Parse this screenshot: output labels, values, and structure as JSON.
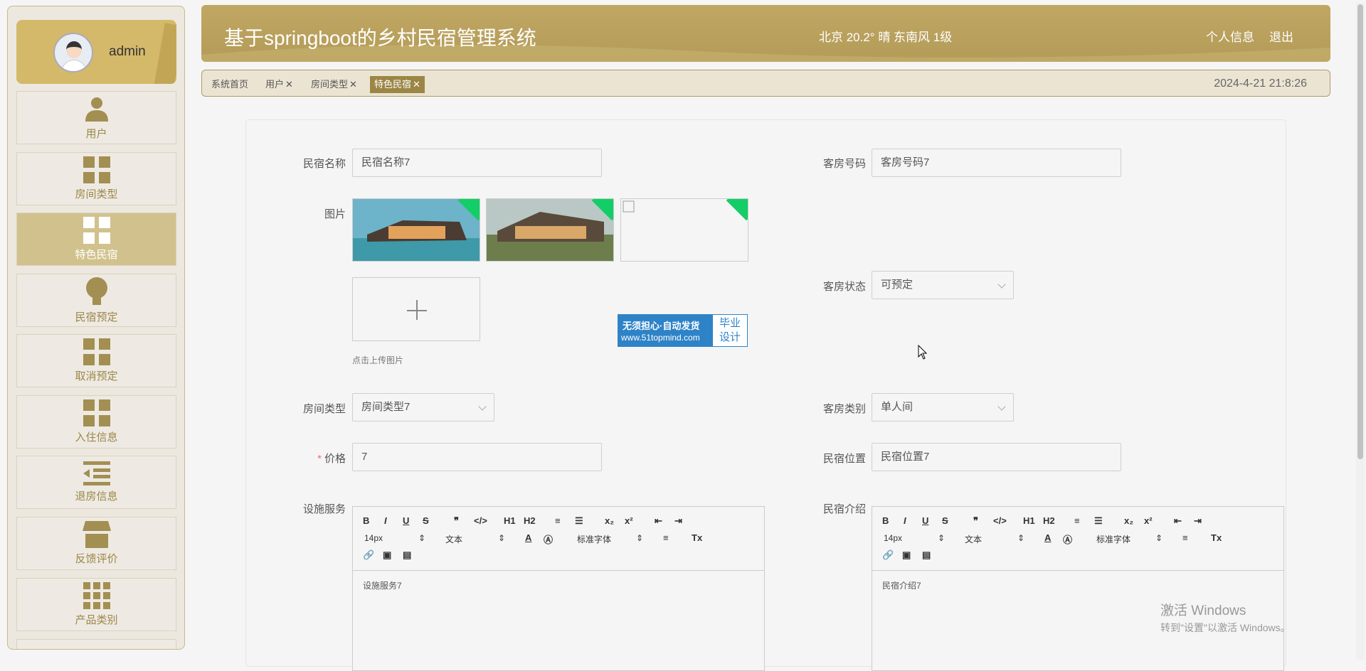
{
  "user": {
    "name": "admin"
  },
  "sidebar": {
    "items": [
      {
        "label": "用户",
        "icon": "user-icon"
      },
      {
        "label": "房间类型",
        "icon": "grid-icon"
      },
      {
        "label": "特色民宿",
        "icon": "grid-icon",
        "active": true
      },
      {
        "label": "民宿预定",
        "icon": "bulb-icon"
      },
      {
        "label": "取消预定",
        "icon": "grid-icon"
      },
      {
        "label": "入住信息",
        "icon": "grid-icon"
      },
      {
        "label": "退房信息",
        "icon": "list-indent-icon"
      },
      {
        "label": "反馈评价",
        "icon": "shop-icon"
      },
      {
        "label": "产品类别",
        "icon": "grid9-icon"
      }
    ]
  },
  "header": {
    "title": "基于springboot的乡村民宿管理系统",
    "weather": "北京  20.2°  晴  东南风  1级",
    "profile_link": "个人信息",
    "logout_link": "退出"
  },
  "tabs": [
    {
      "label": "系统首页"
    },
    {
      "label": "用户"
    },
    {
      "label": "房间类型"
    },
    {
      "label": "特色民宿",
      "active": true
    }
  ],
  "datetime": "2024-4-21 21:8:26",
  "form": {
    "name_label": "民宿名称",
    "name_value": "民宿名称7",
    "room_no_label": "客房号码",
    "room_no_value": "客房号码7",
    "image_label": "图片",
    "upload_hint": "点击上传图片",
    "status_label": "客房状态",
    "status_value": "可预定",
    "room_type_label": "房间类型",
    "room_type_value": "房间类型7",
    "category_label": "客房类别",
    "category_value": "单人间",
    "price_label": "价格",
    "price_value": "7",
    "location_label": "民宿位置",
    "location_value": "民宿位置7",
    "facility_label": "设施服务",
    "facility_value": "设施服务7",
    "intro_label": "民宿介绍",
    "intro_value": "民宿介绍7"
  },
  "editor_toolbar": {
    "font_size": "14px",
    "block": "文本",
    "font": "标准字体"
  },
  "watermark": {
    "line1": "无须担心·自动发货",
    "line2": "www.51topmind.com",
    "badge1": "毕业",
    "badge2": "设计"
  },
  "windows": {
    "line1": "激活 Windows",
    "line2": "转到\"设置\"以激活 Windows。"
  },
  "colors": {
    "accent": "#b39b58",
    "active_tab": "#9b8645",
    "required": "#f56c6c"
  }
}
